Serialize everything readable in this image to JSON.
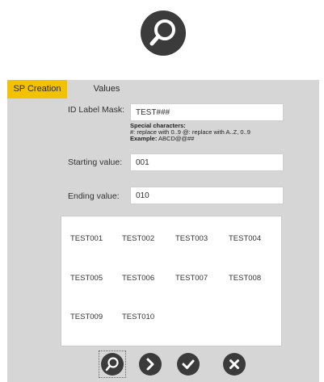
{
  "tabs": {
    "active": "SP Creation",
    "other": "Values"
  },
  "form": {
    "mask_label": "ID Label Mask:",
    "mask_value": "TEST###",
    "help_title": "Special characters:",
    "help_line1": "#: replace with 0..9 @: replace with A..Z, 0..9",
    "help_example_label": "Example:",
    "help_example_value": "ABCD@@##",
    "start_label": "Starting value:",
    "start_value": "001",
    "end_label": "Ending value:",
    "end_value": "010"
  },
  "preview": {
    "items": [
      "TEST001",
      "TEST002",
      "TEST003",
      "TEST004",
      "TEST005",
      "TEST006",
      "TEST007",
      "TEST008",
      "TEST009",
      "TEST010"
    ]
  },
  "icons": {
    "top": "search-icon",
    "buttons": [
      "search-icon",
      "chevron-right-icon",
      "checkmark-icon",
      "close-icon"
    ]
  },
  "colors": {
    "accent": "#f2c100",
    "panel_bg": "#d6d6d6",
    "icon_bg": "#3b3b3b"
  }
}
